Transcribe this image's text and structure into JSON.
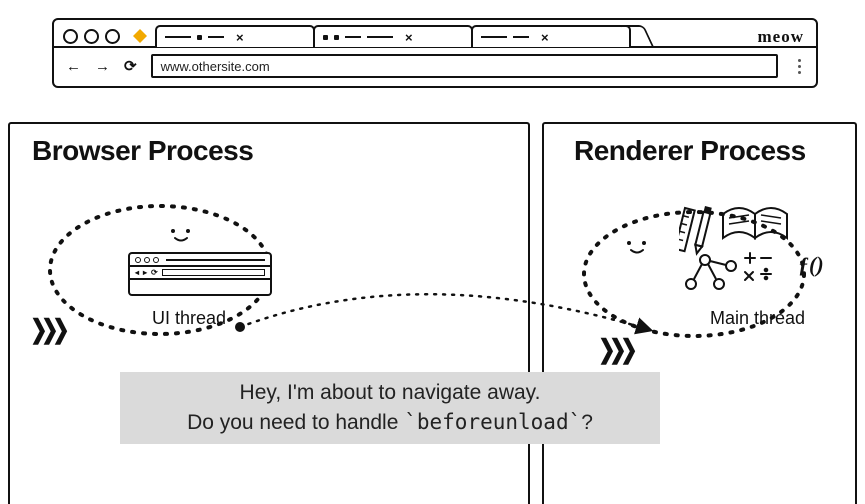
{
  "chrome": {
    "url": "www.othersite.com",
    "brand_text": "meow",
    "nav": {
      "back": "←",
      "forward": "→",
      "reload": "⟳"
    },
    "tab_close": "×",
    "diamond_color": "#f2a900"
  },
  "left_panel": {
    "title": "Browser Process",
    "thread_label": "UI thread"
  },
  "right_panel": {
    "title": "Renderer Process",
    "thread_label": "Main thread",
    "fx_label": "ƒ()"
  },
  "speech": {
    "line1": "Hey, I'm about to navigate away.",
    "line2_pre": "Do you need to handle ",
    "line2_code": "`beforeunload`",
    "line2_post": "?"
  },
  "glyphs": {
    "smile": "· ·  ",
    "chevrons": "❯❯❯"
  }
}
